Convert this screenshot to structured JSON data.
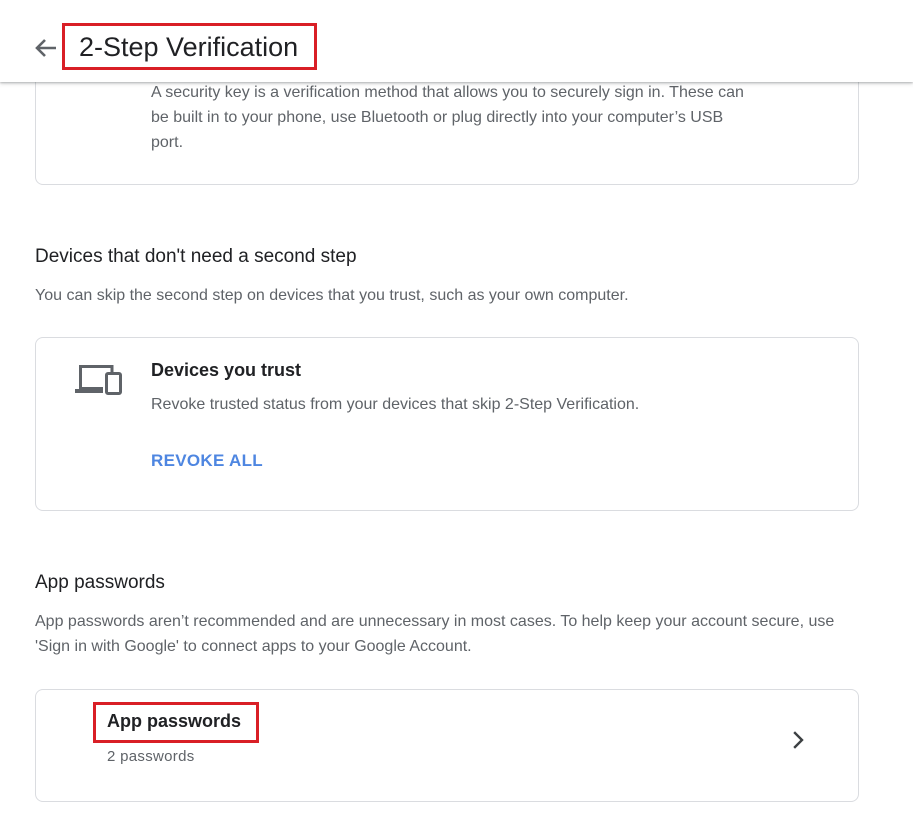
{
  "header": {
    "title": "2-Step Verification",
    "back_icon": "arrow-left-icon"
  },
  "security_key": {
    "description": "A security key is a verification method that allows you to securely sign in. These can be built in to your phone, use Bluetooth or plug directly into your computer’s USB port."
  },
  "devices_section": {
    "title": "Devices that don't need a second step",
    "description": "You can skip the second step on devices that you trust, such as your own computer.",
    "card": {
      "icon": "devices-icon",
      "title": "Devices you trust",
      "description": "Revoke trusted status from your devices that skip 2-Step Verification.",
      "action_label": "REVOKE ALL"
    }
  },
  "app_passwords_section": {
    "title": "App passwords",
    "description": "App passwords aren’t recommended and are unnecessary in most cases. To help keep your account secure, use 'Sign in with Google' to connect apps to your Google Account.",
    "card": {
      "title": "App passwords",
      "subtitle": "2 passwords",
      "icon": "chevron-right-icon"
    }
  },
  "colors": {
    "accent_blue": "#4e86e1",
    "highlight_red": "#d91f26",
    "text_primary": "#202124",
    "text_secondary": "#5f6368",
    "border": "#dadce0"
  }
}
